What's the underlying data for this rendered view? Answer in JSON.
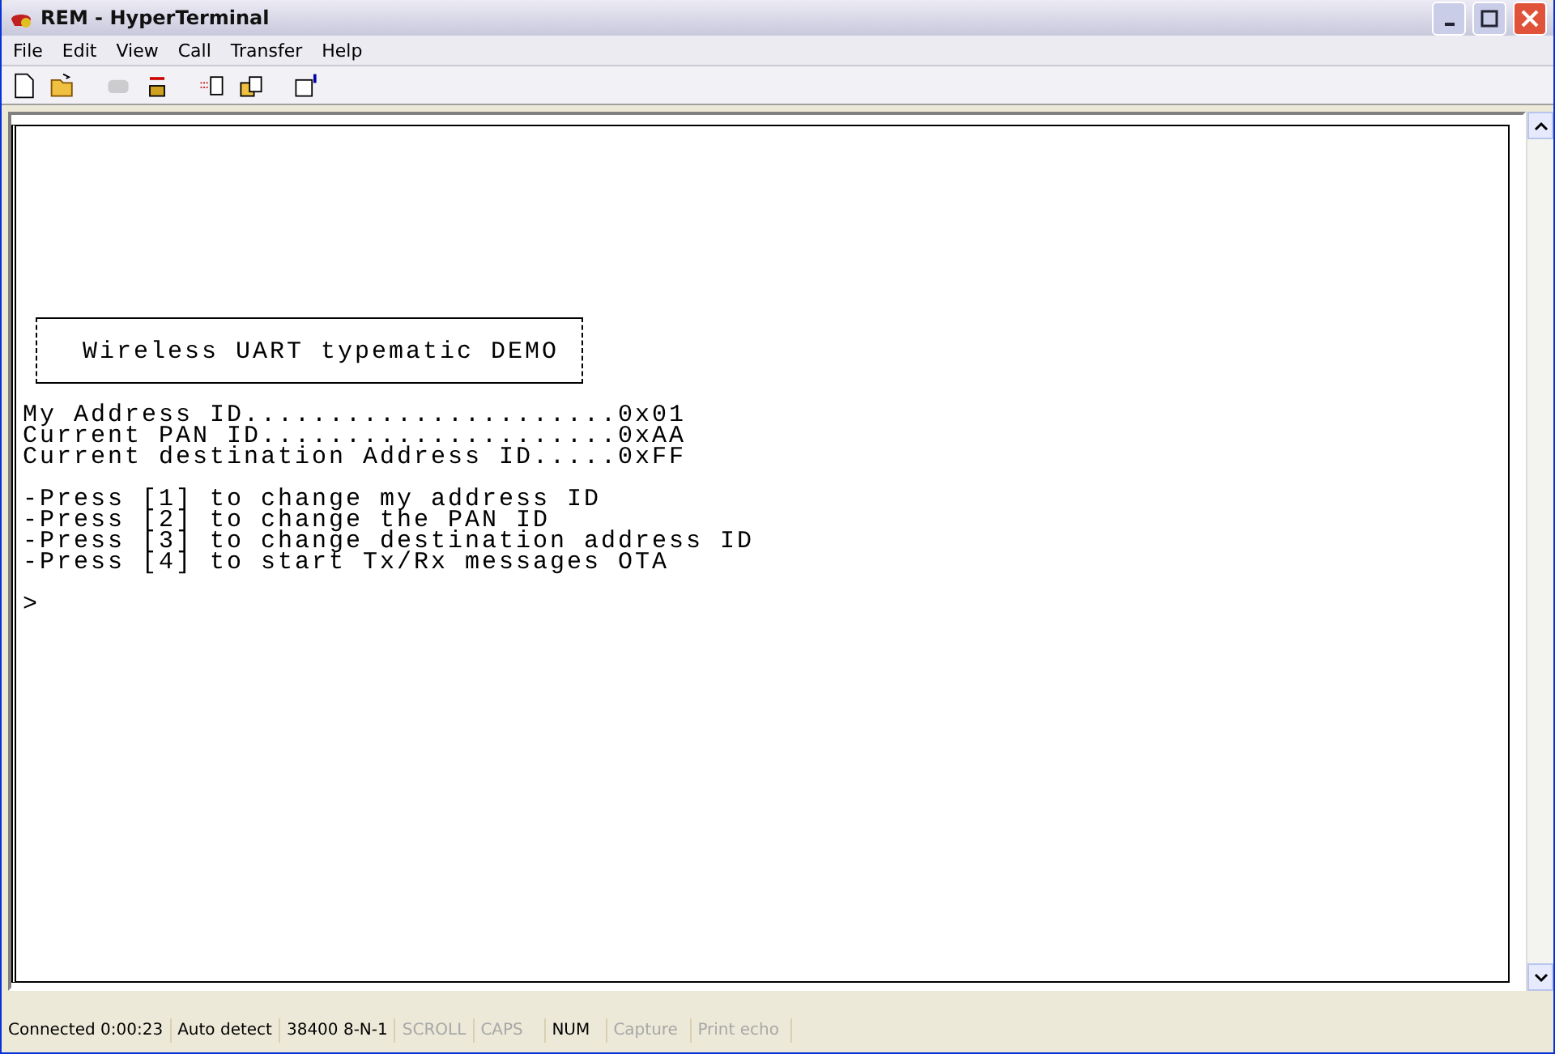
{
  "window": {
    "title": "REM - HyperTerminal"
  },
  "menu": [
    "File",
    "Edit",
    "View",
    "Call",
    "Transfer",
    "Help"
  ],
  "toolbar": [
    {
      "kind": "new",
      "disabled": false
    },
    {
      "kind": "open",
      "disabled": false
    },
    {
      "kind": "call",
      "disabled": true
    },
    {
      "kind": "disconnect",
      "disabled": false
    },
    {
      "kind": "send",
      "disabled": false
    },
    {
      "kind": "receive",
      "disabled": false
    },
    {
      "kind": "properties",
      "disabled": false
    }
  ],
  "terminal": {
    "banner": "Wireless UART typematic DEMO",
    "settings": [
      "My Address ID......................0x01",
      "Current PAN ID.....................0xAA",
      "Current destination Address ID.....0xFF"
    ],
    "options": [
      "-Press [1] to change my address ID",
      "-Press [2] to change the PAN ID",
      "-Press [3] to change destination address ID",
      "-Press [4] to start Tx/Rx messages OTA"
    ],
    "prompt": ">"
  },
  "status_bar": [
    {
      "text": "Connected 0:00:23",
      "active": true
    },
    {
      "text": "Auto detect",
      "active": true
    },
    {
      "text": "38400 8-N-1",
      "active": true
    },
    {
      "text": "SCROLL",
      "active": false
    },
    {
      "text": "CAPS",
      "active": false
    },
    {
      "text": "NUM",
      "active": true
    },
    {
      "text": "Capture",
      "active": false
    },
    {
      "text": "Print echo",
      "active": false
    }
  ]
}
